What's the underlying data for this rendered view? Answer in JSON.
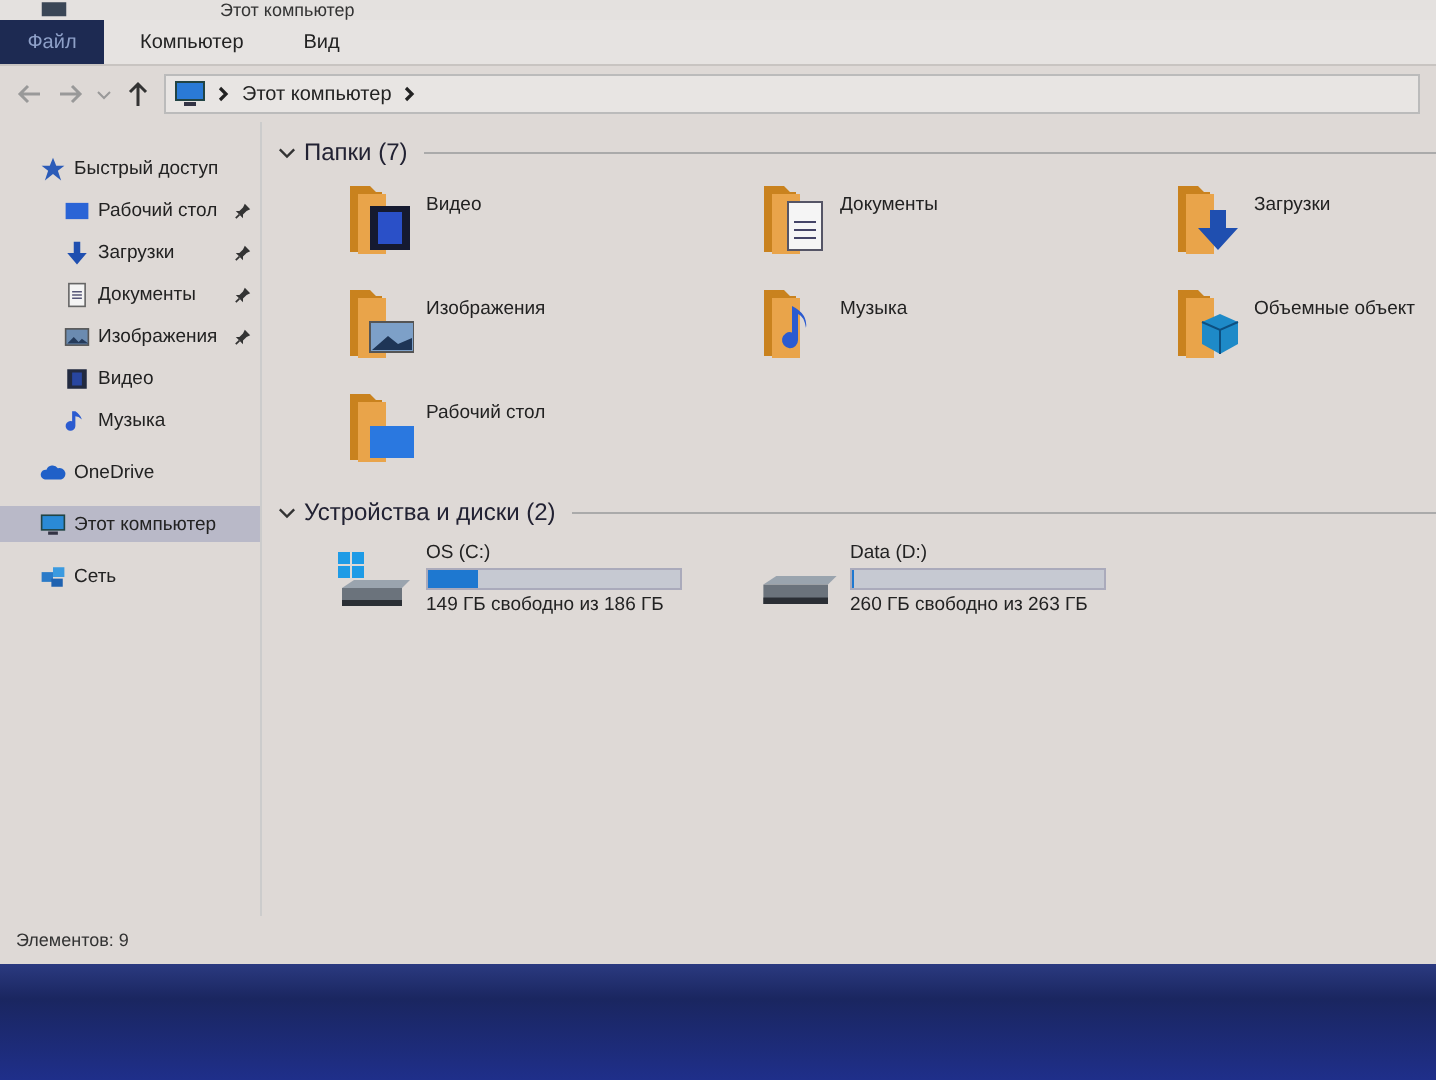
{
  "window": {
    "title": "Этот компьютер"
  },
  "ribbon_tabs": [
    {
      "label": "Файл",
      "selected": true
    },
    {
      "label": "Компьютер",
      "selected": false
    },
    {
      "label": "Вид",
      "selected": false
    }
  ],
  "address_bar": {
    "path": "Этот компьютер"
  },
  "sidebar": {
    "items": [
      {
        "label": "Быстрый доступ",
        "kind": "star",
        "selected": false,
        "children": [
          {
            "label": "Рабочий стол",
            "kind": "desktop",
            "pinned": true,
            "selected": false
          },
          {
            "label": "Загрузки",
            "kind": "download",
            "pinned": true,
            "selected": false
          },
          {
            "label": "Документы",
            "kind": "document",
            "pinned": true,
            "selected": false
          },
          {
            "label": "Изображения",
            "kind": "image",
            "pinned": true,
            "selected": false
          },
          {
            "label": "Видео",
            "kind": "video",
            "pinned": false,
            "selected": false
          },
          {
            "label": "Музыка",
            "kind": "music",
            "pinned": false,
            "selected": false
          }
        ]
      },
      {
        "label": "OneDrive",
        "kind": "cloud",
        "selected": false
      },
      {
        "label": "Этот компьютер",
        "kind": "computer",
        "selected": true
      },
      {
        "label": "Сеть",
        "kind": "network",
        "selected": false
      }
    ]
  },
  "folders": {
    "heading": "Папки (7)",
    "items": [
      {
        "label": "Видео",
        "kind": "video"
      },
      {
        "label": "Документы",
        "kind": "document"
      },
      {
        "label": "Загрузки",
        "kind": "download"
      },
      {
        "label": "Изображения",
        "kind": "image"
      },
      {
        "label": "Музыка",
        "kind": "music"
      },
      {
        "label": "Объемные объект",
        "kind": "cube"
      },
      {
        "label": "Рабочий стол",
        "kind": "desktop"
      }
    ]
  },
  "drives": {
    "heading": "Устройства и диски (2)",
    "items": [
      {
        "label": "OS (C:)",
        "kind": "system",
        "level": 0.2,
        "free": "149 ГБ свободно из 186 ГБ"
      },
      {
        "label": "Data (D:)",
        "kind": "data",
        "level": 0.01,
        "free": "260 ГБ свободно из 263 ГБ"
      }
    ]
  },
  "status_bar": {
    "text": "Элементов: 9"
  }
}
